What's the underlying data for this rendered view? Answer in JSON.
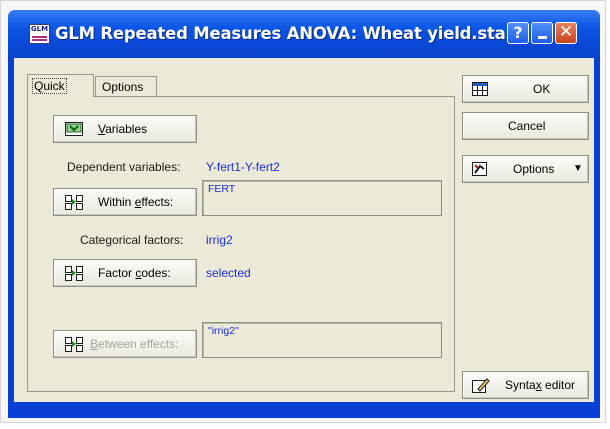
{
  "window": {
    "title": "GLM Repeated Measures ANOVA: Wheat yield.sta",
    "app_icon_text": "GLM",
    "help_glyph": "?",
    "close_glyph": "✕"
  },
  "tabs": [
    {
      "label": "Quick",
      "active": true
    },
    {
      "label": "Options",
      "active": false
    }
  ],
  "quick": {
    "variables_button": {
      "underline": "V",
      "rest": "ariables"
    },
    "dependent_label": "Dependent variables:",
    "dependent_value": "Y-fert1-Y-fert2",
    "within_button": {
      "before": "Within ",
      "underline": "e",
      "after": "ffects:"
    },
    "within_box": "FERT",
    "categorical_label": "Categorical factors:",
    "categorical_value": "irrig2",
    "factor_button": {
      "before": "Factor ",
      "underline": "c",
      "after": "odes:"
    },
    "factor_value": "selected",
    "between_button": {
      "underline": "B",
      "rest": "etween effects:",
      "enabled": false
    },
    "between_box": "\"irrig2\""
  },
  "side": {
    "ok": "OK",
    "cancel": "Cancel",
    "options": "Options",
    "options_arrow": "▼",
    "syntax": {
      "before": "Synta",
      "underline": "x",
      "after": " editor"
    }
  },
  "colors": {
    "title_bar": "#0a48d8",
    "dialog_face": "#ece9d8",
    "value_text": "#1b2fd0",
    "close_button": "#c8471f"
  }
}
